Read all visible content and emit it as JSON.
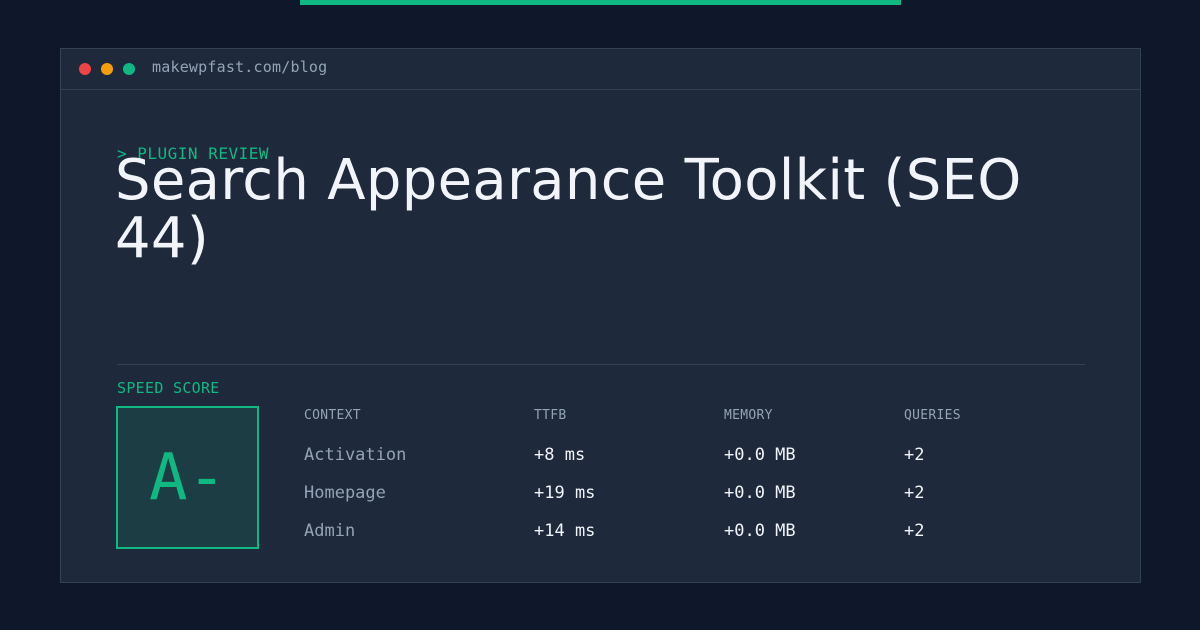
{
  "colors": {
    "background": "#0f172a",
    "card": "#1e293b",
    "border": "#334155",
    "accent": "#10b981",
    "text": "#f1f5f9",
    "muted": "#94a3b8",
    "dot_red": "#ef4444",
    "dot_yellow": "#f59e0b",
    "dot_green": "#10b981"
  },
  "window": {
    "url": "makewpfast.com/blog"
  },
  "kicker": "> PLUGIN REVIEW",
  "title": "Search Appearance Toolkit (SEO 44)",
  "score": {
    "label": "SPEED SCORE",
    "grade": "A-"
  },
  "table": {
    "headers": [
      "CONTEXT",
      "TTFB",
      "MEMORY",
      "QUERIES"
    ],
    "rows": [
      {
        "context": "Activation",
        "ttfb": "+8 ms",
        "memory": "+0.0 MB",
        "queries": "+2"
      },
      {
        "context": "Homepage",
        "ttfb": "+19 ms",
        "memory": "+0.0 MB",
        "queries": "+2"
      },
      {
        "context": "Admin",
        "ttfb": "+14 ms",
        "memory": "+0.0 MB",
        "queries": "+2"
      }
    ]
  }
}
